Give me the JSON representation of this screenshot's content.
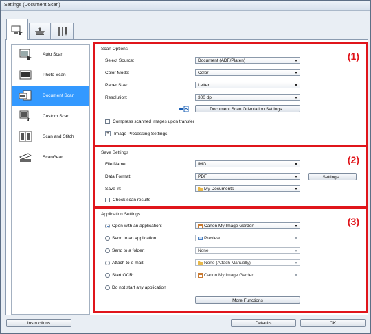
{
  "window": {
    "title": "Settings (Document Scan)"
  },
  "tabs": [
    {
      "name": "scan-from-computer-tab-icon"
    },
    {
      "name": "scan-from-panel-tab-icon"
    },
    {
      "name": "general-settings-tab-icon"
    }
  ],
  "sidebar": {
    "items": [
      {
        "label": "Auto Scan",
        "icon": "auto-scan-icon"
      },
      {
        "label": "Photo Scan",
        "icon": "photo-scan-icon"
      },
      {
        "label": "Document Scan",
        "icon": "document-scan-icon",
        "selected": true
      },
      {
        "label": "Custom Scan",
        "icon": "custom-scan-icon"
      },
      {
        "label": "Scan and Stitch",
        "icon": "scan-and-stitch-icon"
      },
      {
        "label": "ScanGear",
        "icon": "scangear-icon"
      }
    ]
  },
  "scan_options": {
    "title": "Scan Options",
    "marker": "(1)",
    "select_source_label": "Select Source:",
    "select_source_value": "Document (ADF/Platen)",
    "color_mode_label": "Color Mode:",
    "color_mode_value": "Color",
    "paper_size_label": "Paper Size:",
    "paper_size_value": "Letter",
    "resolution_label": "Resolution:",
    "resolution_value": "300 dpi",
    "orientation_button": "Document Scan Orientation Settings...",
    "compress_label": "Compress scanned images upon transfer",
    "compress_checked": false,
    "image_processing_label": "Image Processing Settings",
    "image_processing_toggle": "+"
  },
  "save_settings": {
    "title": "Save Settings",
    "marker": "(2)",
    "file_name_label": "File Name:",
    "file_name_value": "IMG",
    "data_format_label": "Data Format:",
    "data_format_value": "PDF",
    "settings_button": "Settings...",
    "save_in_label": "Save in:",
    "save_in_value": "My Documents",
    "check_results_label": "Check scan results",
    "check_results_checked": false
  },
  "application_settings": {
    "title": "Application Settings",
    "marker": "(3)",
    "options": [
      {
        "label": "Open with an application:",
        "value": "Canon My Image Garden",
        "selected": true,
        "enabled": true
      },
      {
        "label": "Send to an application:",
        "value": "Preview",
        "selected": false,
        "enabled": false
      },
      {
        "label": "Send to a folder:",
        "value": "None",
        "selected": false,
        "enabled": false
      },
      {
        "label": "Attach to e-mail:",
        "value": "None (Attach Manually)",
        "selected": false,
        "enabled": false
      },
      {
        "label": "Start OCR:",
        "value": "Canon My Image Garden",
        "selected": false,
        "enabled": false
      },
      {
        "label": "Do not start any application",
        "selected": false
      }
    ],
    "more_functions_button": "More Functions"
  },
  "footer": {
    "instructions_button": "Instructions",
    "defaults_button": "Defaults",
    "ok_button": "OK"
  },
  "colors": {
    "accent_selection": "#3399ff",
    "highlight_border": "#e0151b"
  }
}
